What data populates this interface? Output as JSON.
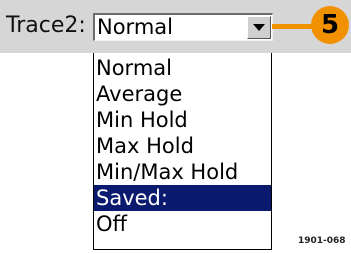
{
  "trace": {
    "label": "Trace2:",
    "selected_value": "Normal"
  },
  "dropdown": {
    "options": [
      {
        "label": "Normal",
        "selected": false
      },
      {
        "label": "Average",
        "selected": false
      },
      {
        "label": "Min Hold",
        "selected": false
      },
      {
        "label": "Max Hold",
        "selected": false
      },
      {
        "label": "Min/Max Hold",
        "selected": false
      },
      {
        "label": "Saved:",
        "selected": true
      },
      {
        "label": "Off",
        "selected": false
      }
    ]
  },
  "callout": {
    "number": "5",
    "color": "#f29100"
  },
  "figure_id": "1901-068",
  "icons": {
    "dropdown_arrow": "chevron-down-icon"
  },
  "colors": {
    "highlight_bg": "#0a1a6e",
    "topbar_bg": "#d6d6d6"
  }
}
